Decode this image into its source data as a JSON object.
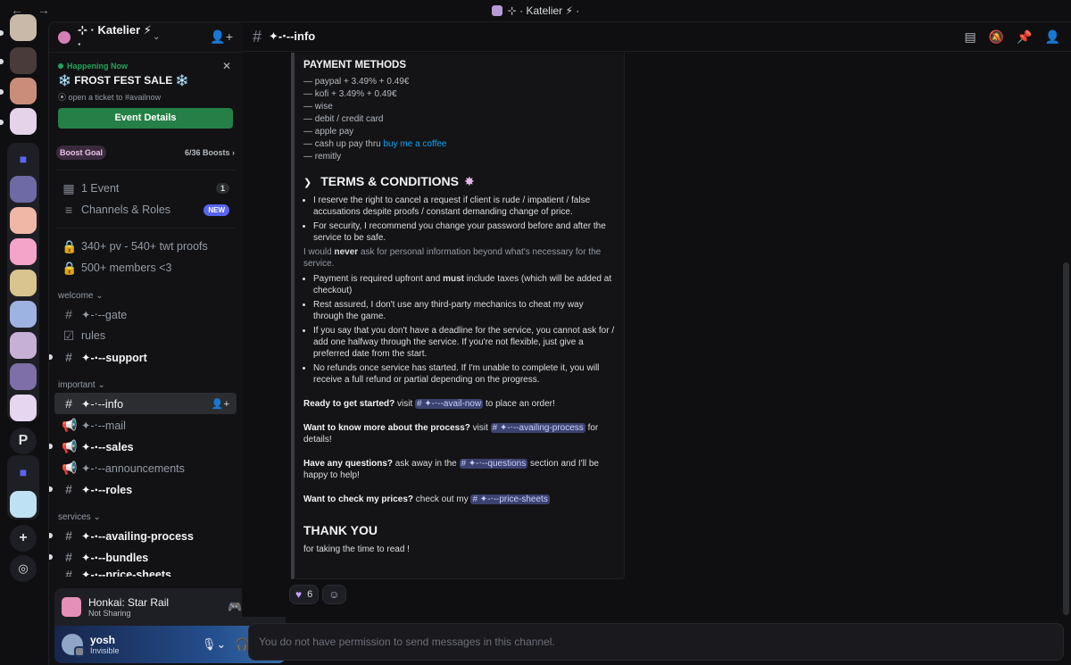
{
  "window": {
    "title": "⊹ · Katelier ⚡ ·",
    "nav": "← →"
  },
  "guild": {
    "name": "⊹ · Katelier ⚡ ·",
    "event": {
      "status": "Happening Now",
      "title": "❄️ FROST FEST SALE ❄️",
      "location": "open a ticket to #availnow",
      "button": "Event Details"
    },
    "boost": {
      "label": "Boost Goal",
      "count": "6/36 Boosts ›"
    }
  },
  "sidebar": {
    "top_items": [
      {
        "label": "1 Event",
        "badge": "1"
      },
      {
        "label": "Channels & Roles",
        "badge": "NEW"
      }
    ],
    "locked": [
      "340+ pv - 540+ twt proofs",
      "500+ members <3"
    ],
    "categories": [
      {
        "name": "welcome ⌄",
        "channels": [
          "✦-‧--gate",
          "rules",
          "✦-‧--support"
        ]
      },
      {
        "name": "important ⌄",
        "channels": [
          "✦-‧--info",
          "✦-‧--mail",
          "✦-‧--sales",
          "✦-‧--announcements",
          "✦-‧--roles"
        ]
      },
      {
        "name": "services ⌄",
        "channels": [
          "✦-‧--availing-process",
          "✦-‧--bundles",
          "✦-‧--price-sheets"
        ]
      }
    ]
  },
  "activity": {
    "game": "Honkai: Star Rail",
    "status": "Not Sharing"
  },
  "user": {
    "name": "yosh",
    "status": "Invisible"
  },
  "channel": {
    "name": "✦-‧--info"
  },
  "message": {
    "payment_heading": "PAYMENT METHODS",
    "payment": [
      "— paypal + 3.49% + 0.49€",
      "— kofi + 3.49% + 0.49€",
      "— wise",
      "— debit / credit card",
      "— apple pay",
      "— cash up pay thru",
      "— remitly"
    ],
    "payment_link": "buy me a coffee",
    "terms_heading": "TERMS & CONDITIONS",
    "terms1": [
      "I reserve the right to cancel a request if client is rude / impatient / false accusations despite proofs / constant demanding change of price.",
      "For security, I recommend you change your password before and after the service to be safe."
    ],
    "note_a": "I would",
    "note_b": "never",
    "note_c": "ask for personal information beyond what's necessary for the service.",
    "pay_a": "Payment is required upfront and",
    "pay_b": "must",
    "pay_c": "include taxes (which will be added at checkout)",
    "terms2": [
      "Rest assured, I don't use any third-party mechanics to cheat my way through the game.",
      "If you say that you don't have a deadline for the service, you cannot ask for / add one halfway through the service. If you're not flexible, just give a preferred date from the start.",
      "No refunds once service has started. If I'm unable to complete it, you will receive a full refund or partial depending on the progress."
    ],
    "cta": [
      {
        "bold": "Ready to get started?",
        "pre": " visit ",
        "mention": "# ✦-‧--avail-now",
        "post": " to place an order!"
      },
      {
        "bold": "Want to know more about the process?",
        "pre": " visit ",
        "mention": "# ✦-‧--availing-process",
        "post": " for details!"
      },
      {
        "bold": "Have any questions?",
        "pre": " ask away in the ",
        "mention": "# ✦-‧--questions",
        "post": " section and I'll be happy to help!"
      },
      {
        "bold": "Want to check my prices?",
        "pre": " check out my ",
        "mention": "# ✦-‧--price-sheets",
        "post": ""
      }
    ],
    "thanks": "THANK YOU",
    "thanks_sub": "for taking the time to read !",
    "reaction_count": "6"
  },
  "composer": {
    "placeholder": "You do not have permission to send messages in this channel."
  },
  "colors": {
    "accent": "#5865f2",
    "event_button": "#248046",
    "link": "#00a8fc"
  }
}
